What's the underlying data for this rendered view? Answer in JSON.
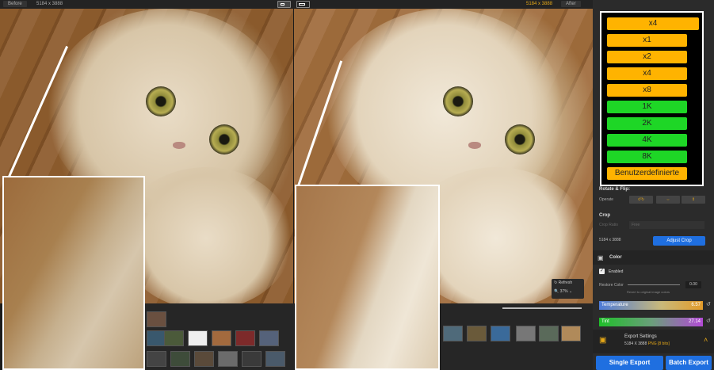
{
  "topbar": {
    "before_label": "Before",
    "before_res": "5184 x 3888",
    "after_res": "5184 x 3888",
    "after_label": "After",
    "compare_icon_1": "split-view-icon",
    "compare_icon_2": "side-by-side-icon"
  },
  "preview": {
    "refresh_label": "Refresh",
    "zoom_value": "37%"
  },
  "scale_menu": {
    "current": "x4",
    "options": [
      "x1",
      "x2",
      "x4",
      "x8",
      "1K",
      "2K",
      "4K",
      "8K",
      "Benutzerdefinierte"
    ],
    "colors": {
      "factor": "#ffb300",
      "resolution": "#1ed626"
    }
  },
  "rotate": {
    "title": "Rotate & Flip:",
    "operate_label": "Operate"
  },
  "crop": {
    "title": "Crop",
    "crop_ratio_label": "Crop Ratio",
    "crop_ratio_value": "Free",
    "size": "5184 x 3888",
    "adjust_button": "Adjust Crop"
  },
  "color": {
    "title": "Color",
    "enabled_label": "Enabled",
    "restore_label": "Restore Color",
    "restore_value": "0.00",
    "restore_hint": "Revert to original image colors",
    "temperature_label": "Temperature",
    "temperature_value": "6.57",
    "tint_label": "Tint",
    "tint_value": "27.14"
  },
  "export": {
    "title": "Export Settings",
    "size": "5184 X 3888",
    "format": "PNG",
    "bits": "[8 bits]",
    "single_button": "Single Export",
    "batch_button": "Batch Export"
  }
}
